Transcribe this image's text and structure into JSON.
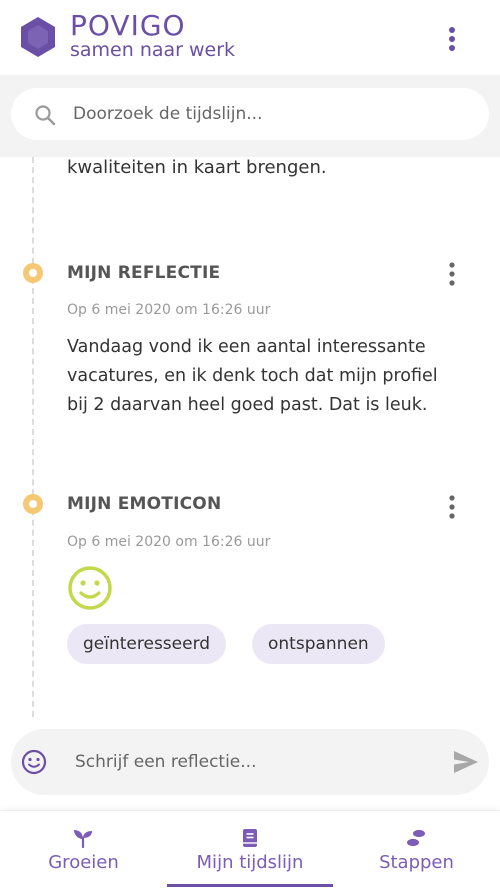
{
  "header": {
    "brand_title": "POVIGO",
    "brand_subtitle": "samen naar werk",
    "logo_icon": "hexagon-logo-icon",
    "menu_icon": "more-vertical-icon"
  },
  "search": {
    "placeholder": "Doorzoek de tijdslijn..."
  },
  "timeline": {
    "partial_text": "kwaliteiten in kaart brengen.",
    "entries": [
      {
        "title": "MIJN REFLECTIE",
        "date": "Op 6 mei 2020 om 16:26 uur",
        "lines": [
          "Vandaag vond ik een aantal interessante",
          "vacatures, en ik denk toch dat mijn profiel",
          "bij 2 daarvan heel goed past. Dat is leuk."
        ]
      },
      {
        "title": "MIJN EMOTICON",
        "date": "Op 6 mei 2020 om 16:26 uur",
        "emoticon": "smiley-icon",
        "tags": [
          "geïnteresseerd",
          "ontspannen"
        ]
      }
    ]
  },
  "composer": {
    "placeholder": "Schrijf een reflectie...",
    "emoji_icon": "smiley-icon",
    "send_icon": "send-icon"
  },
  "bottom_nav": {
    "items": [
      {
        "label": "Groeien",
        "icon": "sprout-icon"
      },
      {
        "label": "Mijn tijdslijn",
        "icon": "book-icon",
        "active": true
      },
      {
        "label": "Stappen",
        "icon": "footsteps-icon"
      }
    ]
  },
  "colors": {
    "brand_purple": "#6b4fa6",
    "dot_yellow": "#f6c874",
    "smiley_green": "#c3d84a",
    "tag_bg": "#ece7f5"
  }
}
